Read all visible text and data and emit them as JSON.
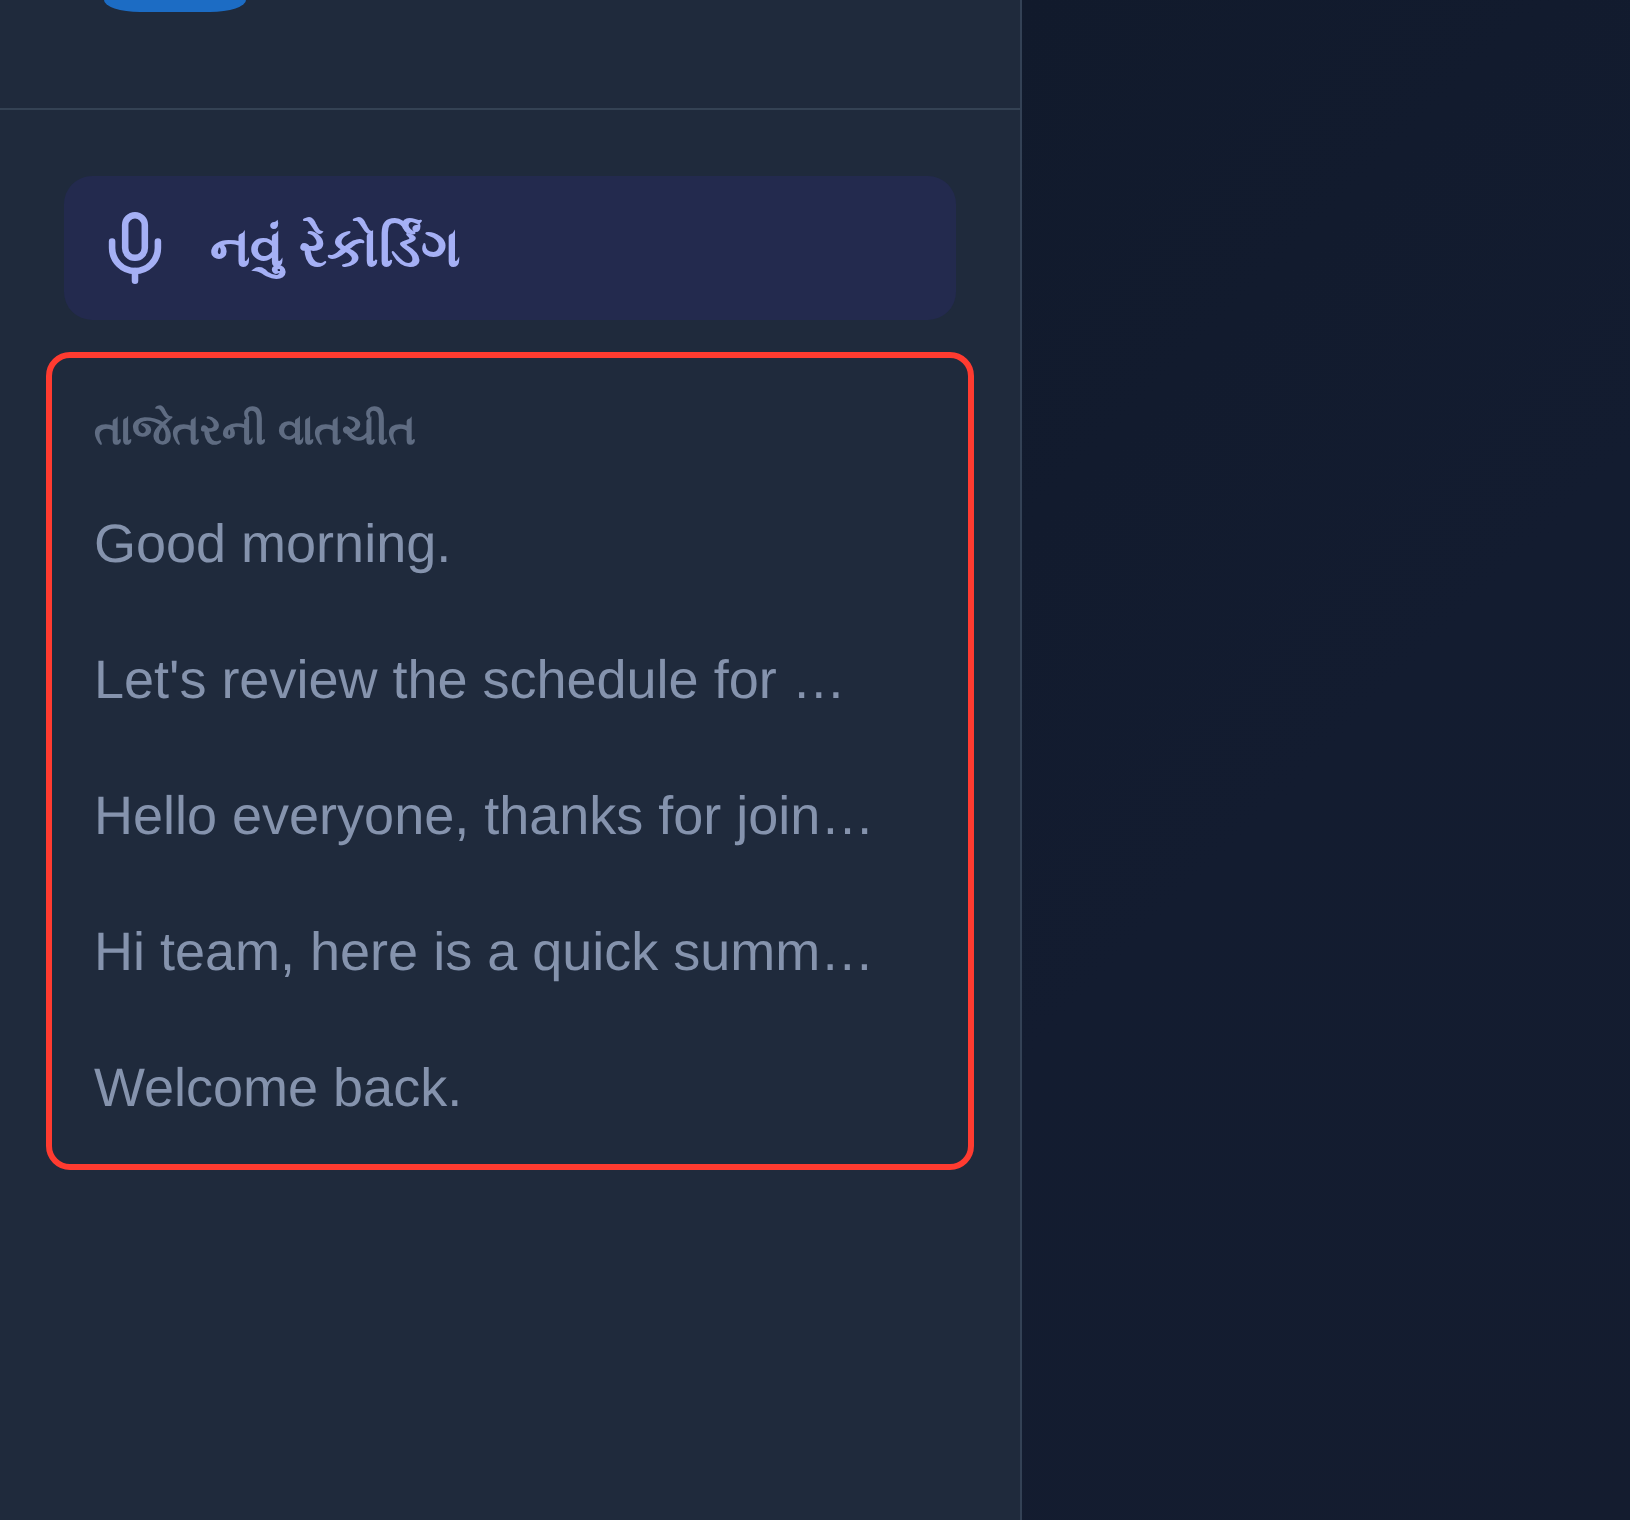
{
  "sidebar": {
    "new_recording_button": {
      "label": "નવું રેકોર્ડિંગ"
    },
    "recent_conversations": {
      "title": "તાજેતરની વાતચીત",
      "highlighted": true,
      "items": [
        {
          "text": "Good morning."
        },
        {
          "text": "Let's review the schedule for …"
        },
        {
          "text": "Hello everyone, thanks for join…"
        },
        {
          "text": "Hi team, here is a quick summ…"
        },
        {
          "text": "Welcome back."
        }
      ]
    }
  }
}
